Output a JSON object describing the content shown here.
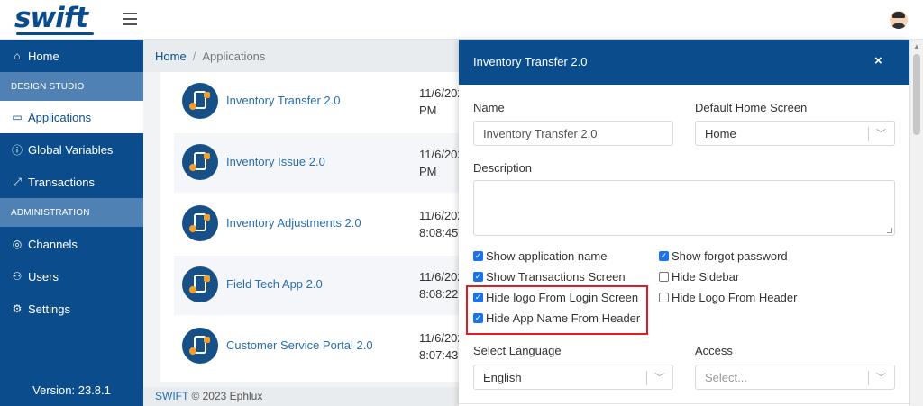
{
  "header": {
    "logo": "swift",
    "menu_icon": "hamburger-icon",
    "avatar_icon": "user-avatar-icon"
  },
  "sidebar": {
    "items": [
      {
        "label": "Home",
        "icon": "home-icon"
      },
      {
        "label": "Applications",
        "icon": "applications-icon"
      },
      {
        "label": "Global Variables",
        "icon": "info-circle-icon"
      },
      {
        "label": "Transactions",
        "icon": "expand-arrows-icon"
      },
      {
        "label": "Channels",
        "icon": "channels-icon"
      },
      {
        "label": "Users",
        "icon": "user-icon"
      },
      {
        "label": "Settings",
        "icon": "gear-icon"
      }
    ],
    "sections": [
      "DESIGN STUDIO",
      "ADMINISTRATION"
    ],
    "version": "Version: 23.8.1"
  },
  "breadcrumb": {
    "home": "Home",
    "sep": "/",
    "current": "Applications"
  },
  "apps": [
    {
      "name": "Inventory Transfer 2.0",
      "date_line1": "11/6/202",
      "date_line2": "PM"
    },
    {
      "name": "Inventory Issue 2.0",
      "date_line1": "11/6/202",
      "date_line2": "PM"
    },
    {
      "name": "Inventory Adjustments 2.0",
      "date_line1": "11/6/202",
      "date_line2": "8:08:45"
    },
    {
      "name": "Field Tech App 2.0",
      "date_line1": "11/6/202",
      "date_line2": "8:08:22"
    },
    {
      "name": "Customer Service Portal 2.0",
      "date_line1": "11/6/202",
      "date_line2": "8:07:43"
    }
  ],
  "footer": {
    "brand": "SWIFT",
    "text": " © 2023 Ephlux"
  },
  "modal": {
    "title": "Inventory Transfer 2.0",
    "close": "×",
    "name_label": "Name",
    "name_value": "Inventory Transfer 2.0",
    "home_screen_label": "Default Home Screen",
    "home_screen_value": "Home",
    "description_label": "Description",
    "description_value": "",
    "checkboxes": [
      {
        "label": "Show application name",
        "checked": true
      },
      {
        "label": "Show forgot password",
        "checked": true
      },
      {
        "label": "Show Transactions Screen",
        "checked": true
      },
      {
        "label": "Hide Sidebar",
        "checked": false
      },
      {
        "label": "Hide logo From Login Screen",
        "checked": true
      },
      {
        "label": "Hide Logo From Header",
        "checked": false
      },
      {
        "label": "Hide App Name From Header",
        "checked": true
      }
    ],
    "language_label": "Select Language",
    "language_value": "English",
    "access_label": "Access",
    "access_placeholder": "Select..."
  },
  "colors": {
    "primary": "#0b4d8c",
    "section": "#4f81b4",
    "link": "#2a6db0",
    "highlight": "#e31b23",
    "checkbox": "#1a73e8"
  }
}
